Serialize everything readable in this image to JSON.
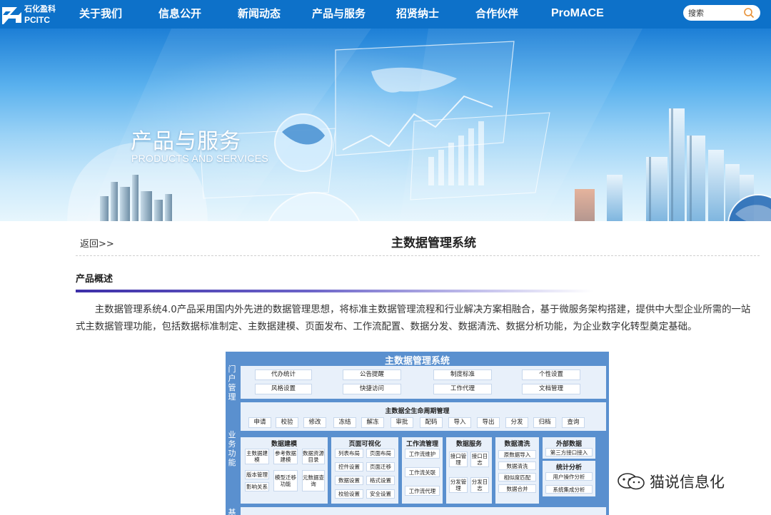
{
  "logo": {
    "cn": "石化盈科",
    "en": "PCITC"
  },
  "nav": [
    "关于我们",
    "信息公开",
    "新闻动态",
    "产品与服务",
    "招贤纳士",
    "合作伙伴",
    "ProMACE"
  ],
  "search": {
    "placeholder": "搜索"
  },
  "banner": {
    "title": "产品与服务",
    "subtitle": "PRODUCTS AND SERVICES"
  },
  "page": {
    "back": "返回>>",
    "title": "主数据管理系统",
    "section": "产品概述",
    "paragraph": "主数据管理系统4.0产品采用国内外先进的数据管理思想，将标准主数据管理流程和行业解决方案相融合，基于微服务架构搭建，提供中大型企业所需的一站式主数据管理功能，包括数据标准制定、主数据建模、页面发布、工作流配置、数据分发、数据清洗、数据分析功能，为企业数字化转型奠定基础。"
  },
  "diagram": {
    "title": "主数据管理系统",
    "portal_label": "门户管理",
    "business_label": "业务功能",
    "portal_items": [
      "代办统计",
      "公告提醒",
      "制度标准",
      "个性设置",
      "风格设置",
      "快捷访问",
      "工作代理",
      "文档管理"
    ],
    "lifecycle_title": "主数据全生命周期管理",
    "lifecycle_items": [
      "申请",
      "校验",
      "修改",
      "冻结",
      "解冻",
      "审批",
      "配码",
      "导入",
      "导出",
      "分发",
      "归档",
      "查询"
    ],
    "modules": [
      {
        "title": "数据建模",
        "items": [
          "主数据建模",
          "参考数据建模",
          "数据资源目录",
          "版本管理",
          "模型迁移功能",
          "元数据查询",
          "影响关系"
        ]
      },
      {
        "title": "页面可视化",
        "items": [
          "列表布局",
          "页面布局",
          "控件设置",
          "页面迁移",
          "数据设置",
          "格式设置",
          "校验设置",
          "安全设置"
        ]
      },
      {
        "title": "工作流管理",
        "items": [
          "工作流维护",
          "工作流关联",
          "工作流代理"
        ]
      },
      {
        "title": "数据服务",
        "items": [
          "接口管理",
          "接口日志",
          "分发管理",
          "分发日志"
        ]
      },
      {
        "title": "数据清洗",
        "items": [
          "原数据导入",
          "数据清洗",
          "相似度匹配",
          "数据合并"
        ]
      },
      {
        "title": "外部数据",
        "items": [
          "第三方接口接入"
        ]
      },
      {
        "title": "统计分析",
        "items": [
          "用户操作分析",
          "系统集成分析"
        ]
      }
    ],
    "bottom_label": "基"
  },
  "watermark": {
    "text": "猫说信息化"
  },
  "colors": {
    "nav": "#0d71c9",
    "diagram": "#5a90cf",
    "panel": "#e8f0fa",
    "accent": "#3d2fa8"
  }
}
